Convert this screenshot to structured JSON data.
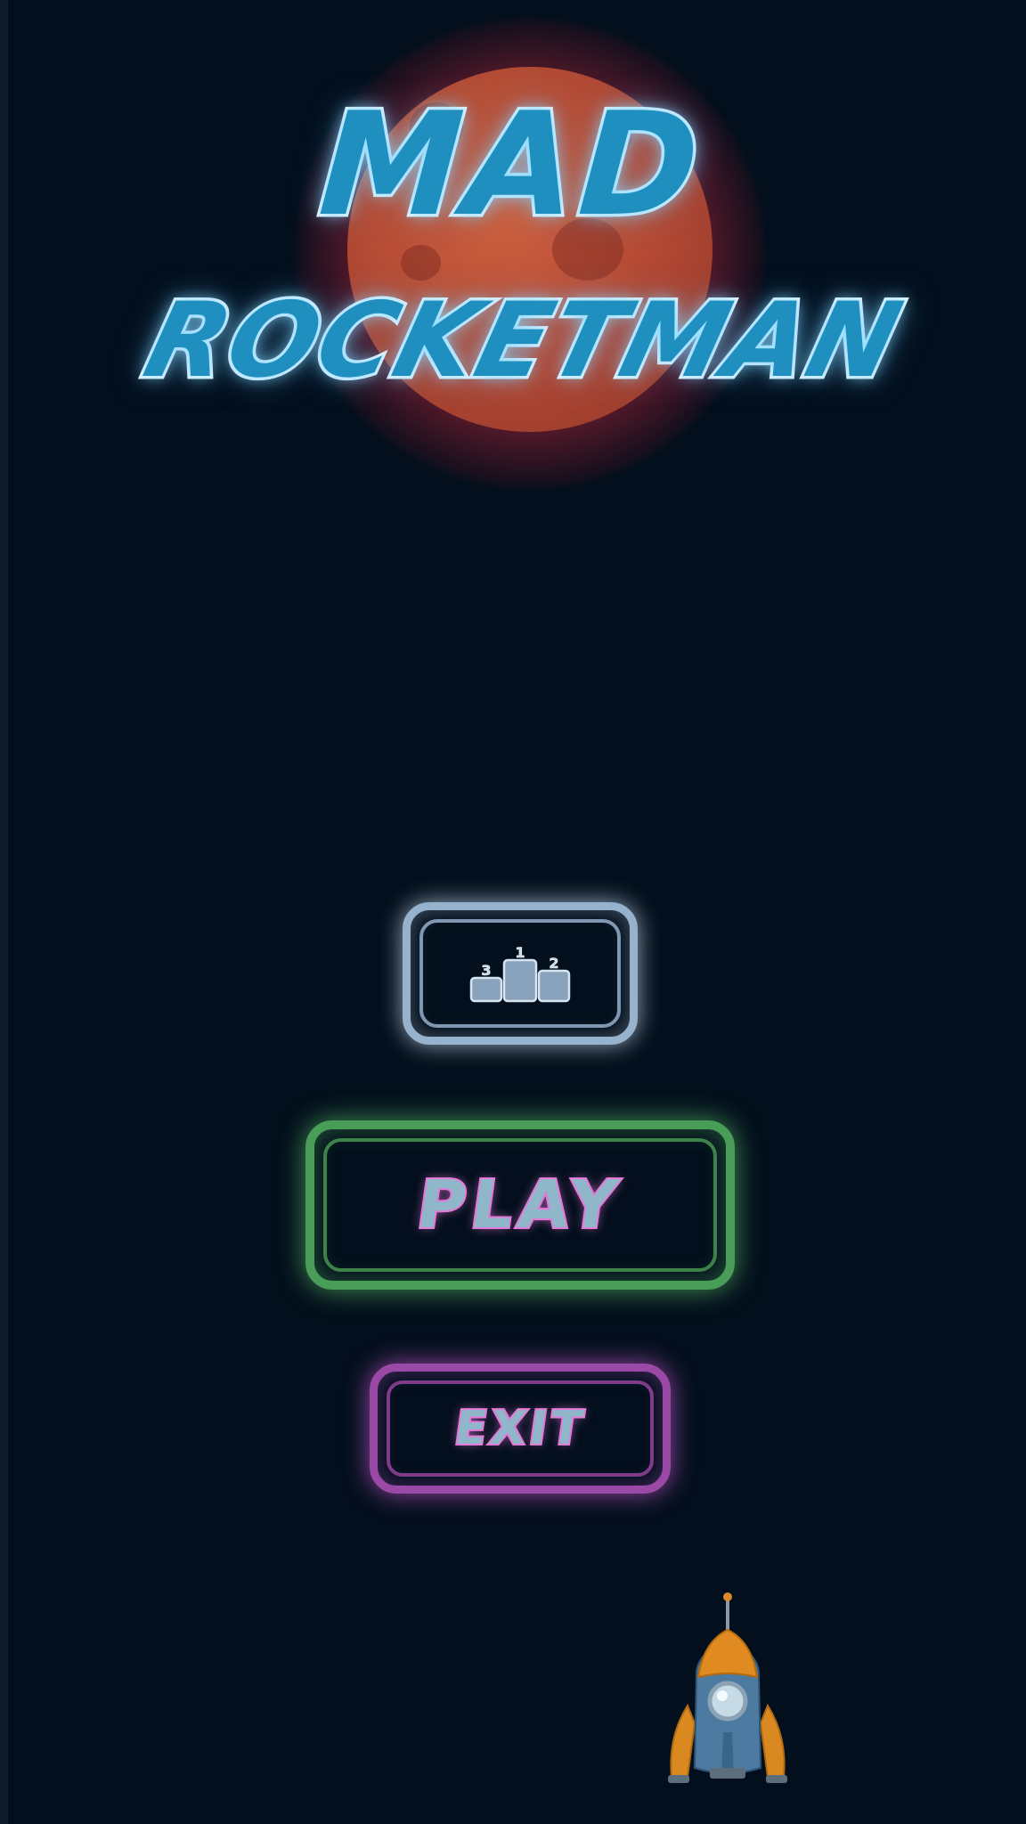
{
  "game": {
    "title_line1": "MAD",
    "title_line2": "ROCKETMAN"
  },
  "menu": {
    "leaderboard_icon": "podium-icon",
    "podium_places": [
      "3",
      "1",
      "2"
    ],
    "play_label": "PLAY",
    "exit_label": "EXIT"
  },
  "colors": {
    "background": "#030f1c",
    "leaderboard_border": "#97b2cd",
    "play_border": "#4a9d58",
    "exit_border": "#9a4aa6",
    "logo_fill": "#1e8fbf",
    "planet": "#c4553a"
  },
  "decor": {
    "planet": "planet",
    "rocket": "rocket"
  }
}
